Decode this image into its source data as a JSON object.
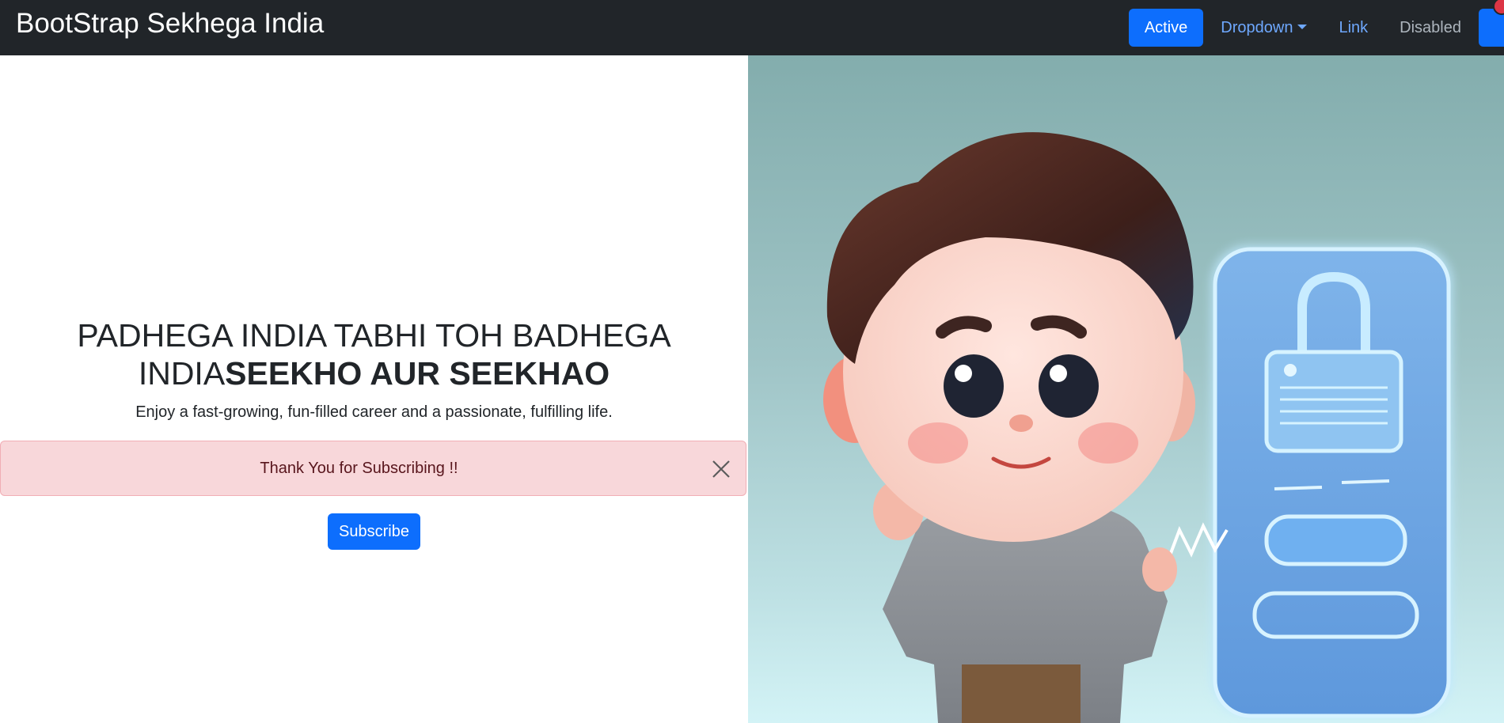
{
  "navbar": {
    "brand": "BootStrap Sekhega India",
    "items": [
      {
        "label": "Active"
      },
      {
        "label": "Dropdown"
      },
      {
        "label": "Link"
      },
      {
        "label": "Disabled"
      }
    ]
  },
  "hero": {
    "headline_regular": "PADHEGA INDIA TABHI TOH BADHEGA INDIA",
    "headline_bold": "SEEKHO AUR SEEKHAO",
    "lead": "Enjoy a fast-growing, fun-filled career and a passionate, fulfilling life.",
    "alert": {
      "message": "Thank You for Subscribing !!"
    },
    "subscribe_label": "Subscribe"
  },
  "colors": {
    "navbar_bg": "#212529",
    "primary": "#0d6efd",
    "nav_link": "#6ea8fe",
    "alert_bg": "#f8d7da",
    "alert_border": "#f1aeb5",
    "alert_text": "#58151c",
    "badge": "#dc3545"
  },
  "icons": {
    "alert_close": "close-icon",
    "dropdown_caret": "caret-down-icon",
    "illustration": "cartoon-boy-with-phone-lock-illustration"
  }
}
